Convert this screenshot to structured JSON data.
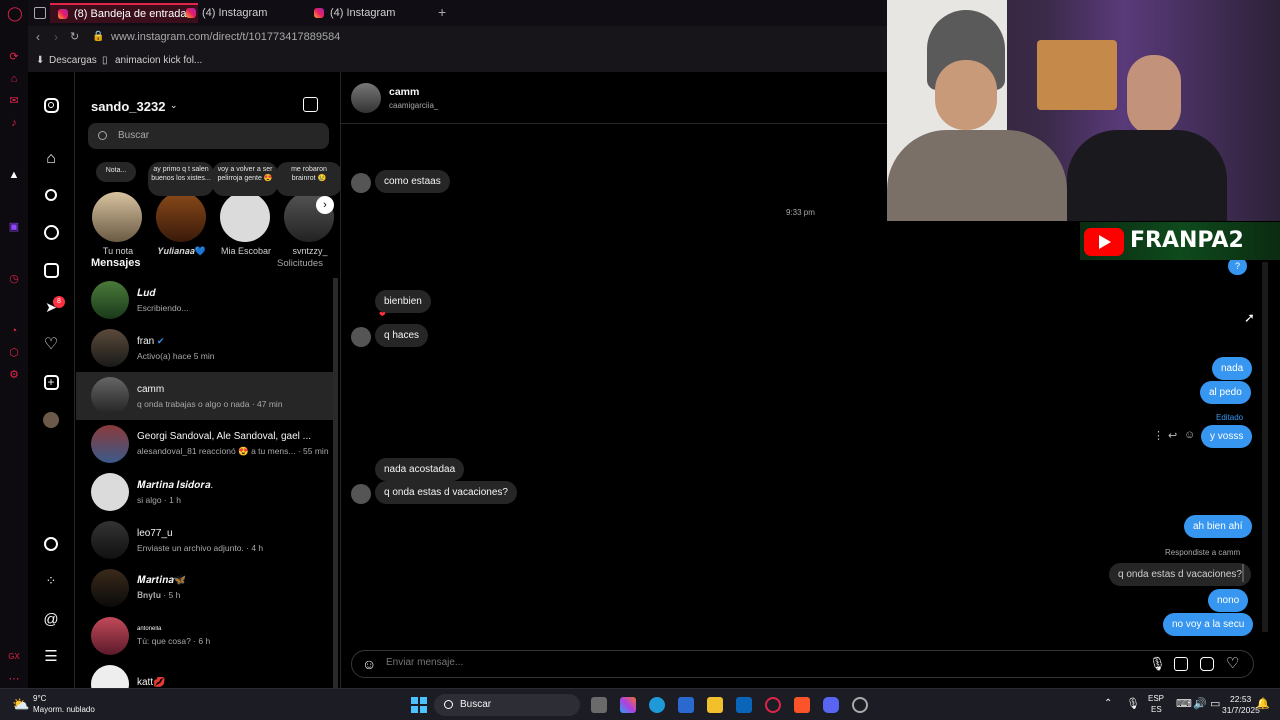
{
  "tabs": [
    {
      "label": "(8) Bandeja de entrada •"
    },
    {
      "label": "(4) Instagram"
    },
    {
      "label": "(4) Instagram"
    }
  ],
  "address": {
    "url": "www.instagram.com/direct/t/101773417889584"
  },
  "bookmarks": [
    {
      "label": "Descargas"
    },
    {
      "label": "animacion kick fol..."
    }
  ],
  "rail": {
    "badge": "8"
  },
  "inbox": {
    "username": "sando_3232",
    "search_placeholder": "Buscar",
    "notes": [
      {
        "bubble": "Nota...",
        "name": "Tu nota"
      },
      {
        "bubble": "ay primo q t salen buenos los xistes...",
        "name": "𝒀𝒖𝒍𝒊𝒂𝒏𝒂𝒂💙"
      },
      {
        "bubble": "voy a volver a ser pelirroja gente 😍",
        "name": "Mia Escobar"
      },
      {
        "bubble": "me robaron brainrot 😢",
        "name": "svntzzy_"
      }
    ],
    "messages_label": "Mensajes",
    "requests_label": "Solicitudes",
    "conversations": [
      {
        "name": "𝑳𝒖𝒅",
        "preview": "Escribiendo..."
      },
      {
        "name": "fran",
        "preview": "Activo(a) hace 5 min"
      },
      {
        "name": "camm",
        "preview": "q onda trabajas o algo o nada · 47 min"
      },
      {
        "name": "Georgi Sandoval, Ale Sandoval, gael ...",
        "preview": "alesandoval_81 reaccionó 😍 a tu mens... · 55 min"
      },
      {
        "name": "𝑴𝒂𝒓𝒕𝒊𝒏𝒂 𝑰𝒔𝒊𝒅𝒐𝒓𝒂.",
        "preview": "si algo · 1 h"
      },
      {
        "name": "leo77_u",
        "preview": "Enviaste un archivo adjunto. · 4 h"
      },
      {
        "name": "𝑴𝒂𝒓𝒕𝒊𝒏𝒂🦋",
        "preview": "𝐁𝐧𝐲𝐭𝐮 · 5 h"
      },
      {
        "name": "antonella",
        "preview": "Tú: que cosa? · 6 h"
      },
      {
        "name": "katt💋",
        "preview": ""
      }
    ]
  },
  "chat": {
    "name": "camm",
    "handle": "caamigarciia_",
    "messages_in": [
      {
        "text": "como estaas"
      },
      {
        "text": "bienbien"
      },
      {
        "text": "q haces"
      },
      {
        "text": "nada acostadaa"
      },
      {
        "text": "q onda estas d vacaciones?"
      }
    ],
    "time_label": "9:33 pm",
    "reaction": "❤",
    "messages_out": [
      {
        "text": "?"
      },
      {
        "text": "nada"
      },
      {
        "text": "al pedo"
      },
      {
        "text": "y vosss"
      },
      {
        "text": "ah bien ahí"
      },
      {
        "text": "nono"
      },
      {
        "text": "no voy a la secu"
      }
    ],
    "edited_label": "Editado",
    "replied_label": "Respondiste a camm",
    "quoted_text": "q onda estas d vacaciones?",
    "composer_placeholder": "Enviar mensaje..."
  },
  "overlay": {
    "brand": "FRANPA2"
  },
  "taskbar": {
    "temp": "9°C",
    "weather": "Mayorm. nublado",
    "search": "Buscar",
    "lang1": "ESP",
    "lang2": "ES",
    "time": "22:53",
    "date": "31/7/2025"
  },
  "colors": {
    "accent": "#e0244a",
    "ig_blue": "#3797f0",
    "bubble_in": "#262626"
  }
}
